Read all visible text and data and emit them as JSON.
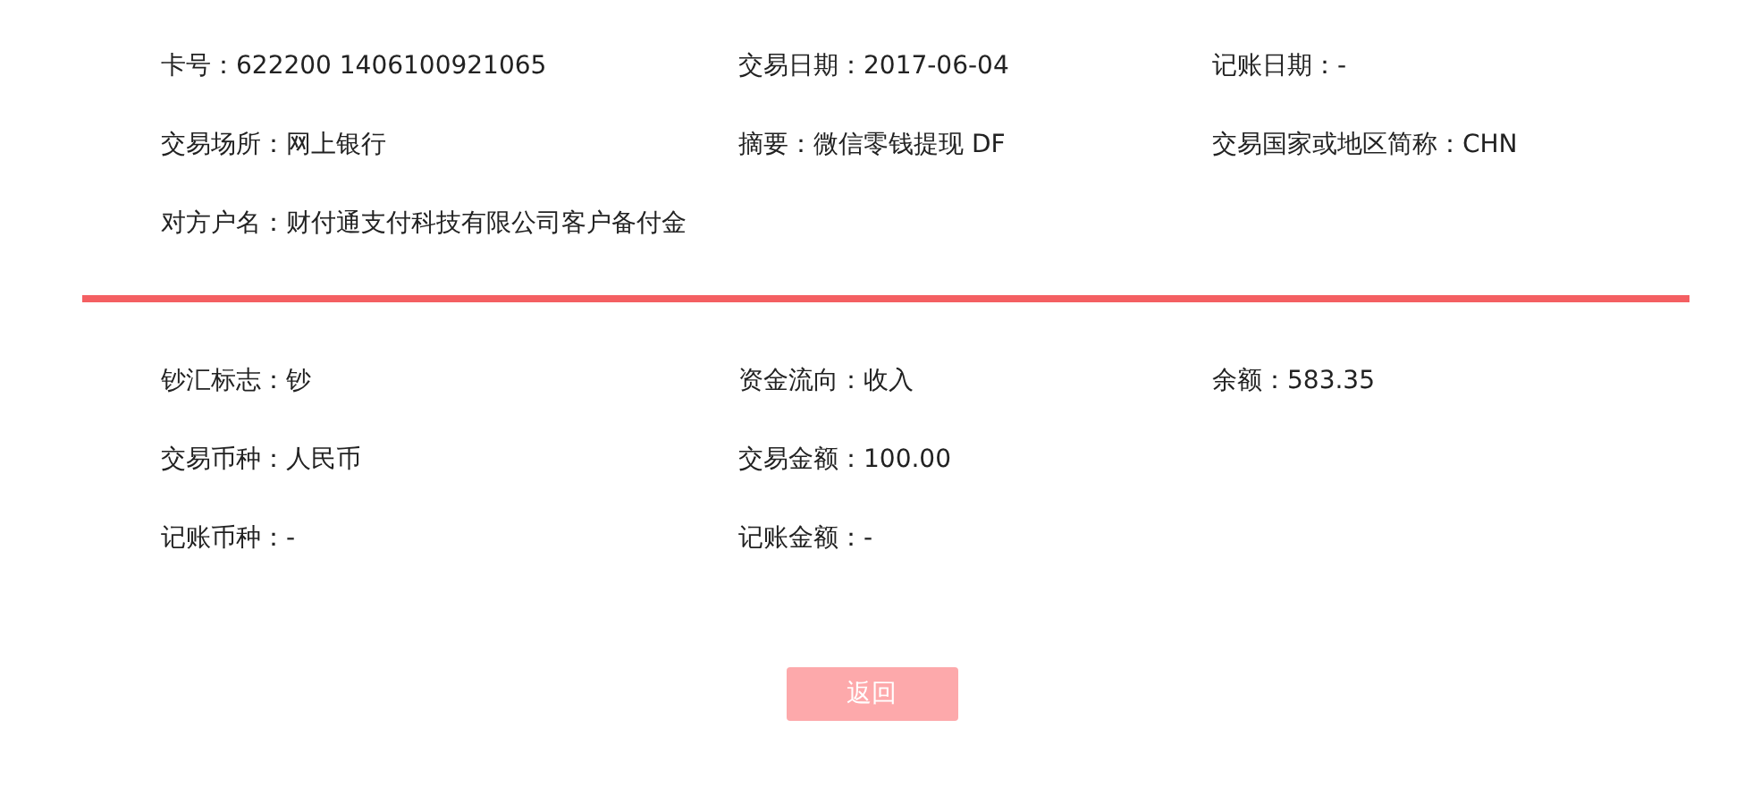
{
  "sections": [
    {
      "rows": [
        [
          "卡号：622200 1406100921065",
          "交易日期：2017-06-04",
          "记账日期：-"
        ],
        [
          "交易场所：网上银行",
          "摘要：微信零钱提现 DF",
          "交易国家或地区简称：CHN"
        ],
        [
          "对方户名：财付通支付科技有限公司客户备付金"
        ]
      ]
    },
    {
      "rows": [
        [
          "钞汇标志：钞",
          "资金流向：收入",
          "余额：583.35"
        ],
        [
          "交易币种：人民币",
          "交易金额：100.00"
        ],
        [
          "记账币种：-",
          "记账金额：-"
        ]
      ]
    }
  ],
  "back_button": {
    "label": "返回"
  }
}
